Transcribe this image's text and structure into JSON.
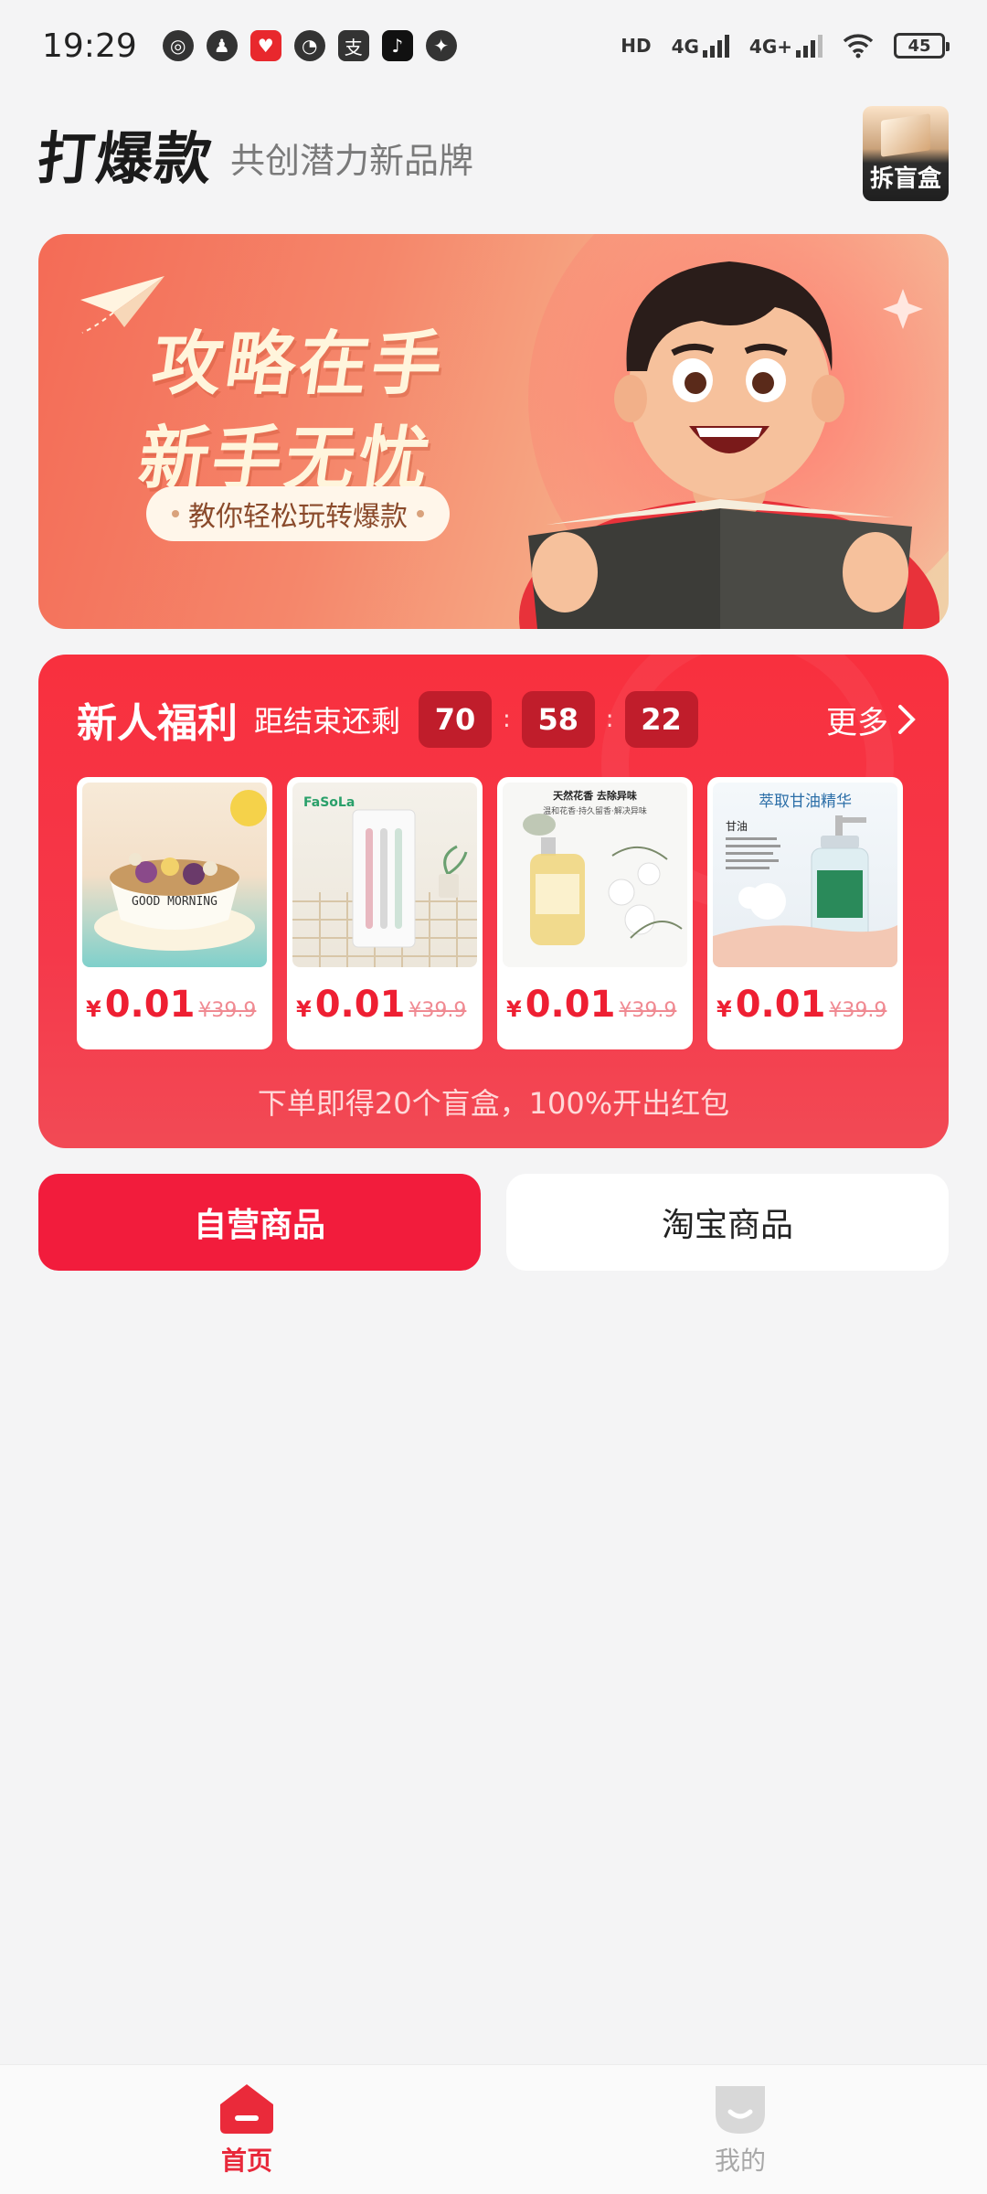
{
  "status_bar": {
    "time": "19:29",
    "network": [
      "HD",
      "4G",
      "4G+"
    ],
    "battery": "45"
  },
  "header": {
    "brand": "打爆款",
    "slogan": "共创潜力新品牌",
    "blindbox_label": "拆盲盒"
  },
  "guide_banner": {
    "title_line1": "攻略在手",
    "title_line2": "新手无忧",
    "pill": "教你轻松玩转爆款"
  },
  "newcomer": {
    "title": "新人福利",
    "countdown_label": "距结束还剩",
    "countdown": [
      "70",
      "58",
      "22"
    ],
    "more": "更多",
    "products": [
      {
        "name": "GOOD MORNING",
        "price_currency": "¥",
        "price": "0.01",
        "original_price": "¥39.9"
      },
      {
        "name": "FaSoLa",
        "price_currency": "¥",
        "price": "0.01",
        "original_price": "¥39.9"
      },
      {
        "name": "天然花香 去除异味",
        "subtitle": "温和花香·持久留香·解决异味",
        "price_currency": "¥",
        "price": "0.01",
        "original_price": "¥39.9"
      },
      {
        "name": "萃取甘油精华",
        "subtitle": "甘油",
        "price_currency": "¥",
        "price": "0.01",
        "original_price": "¥39.9"
      }
    ],
    "footer": "下单即得20个盲盒，100%开出红包"
  },
  "segments": {
    "self": "自营商品",
    "taobao": "淘宝商品"
  },
  "bottom_nav": {
    "home": "首页",
    "mine": "我的"
  },
  "colors": {
    "accent": "#f21c3c",
    "price": "#ee1f32",
    "background": "#f4f4f5"
  }
}
